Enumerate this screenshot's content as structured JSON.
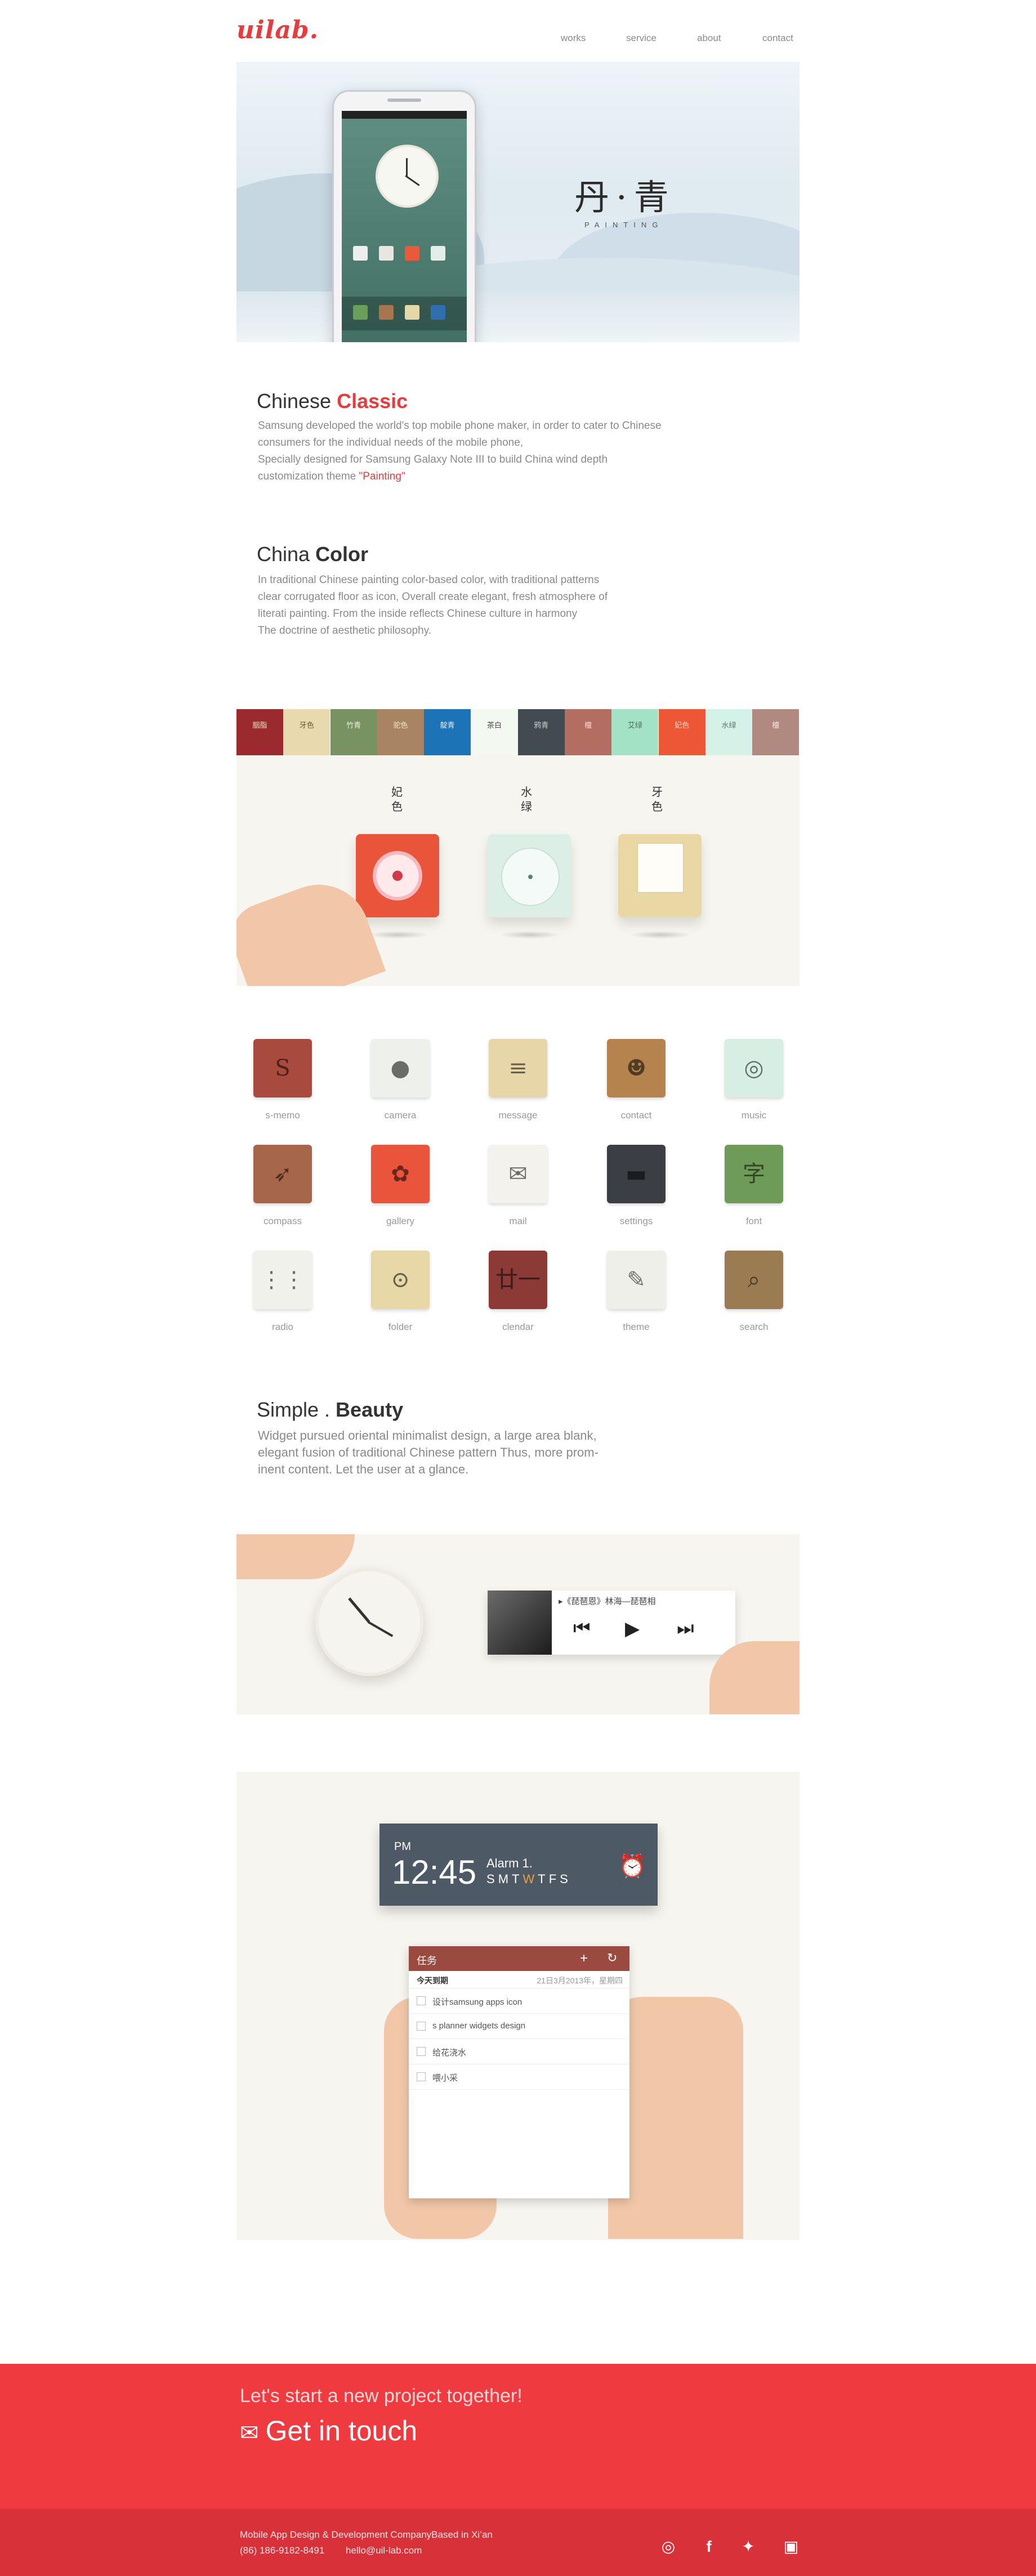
{
  "header": {
    "logo": "uilab.",
    "nav": [
      "works",
      "service",
      "about",
      "contact"
    ]
  },
  "hero": {
    "title": "丹·青",
    "subtitle": "PAINTING"
  },
  "classic": {
    "title_light": "Chinese ",
    "title_accent": "Classic",
    "line1": "Samsung developed the world's top mobile phone maker, in order to cater to Chinese",
    "line2": "consumers for the individual needs of the mobile phone,",
    "line3": "Specially designed for Samsung Galaxy Note III to build China wind depth",
    "line4_prefix": "customization theme ",
    "line4_accent": "\"Painting\""
  },
  "color": {
    "title_light": "China ",
    "title_bold": "Color",
    "line1": "In traditional Chinese painting color-based color, with traditional patterns",
    "line2": "clear corrugated floor as icon, Overall create elegant, fresh atmosphere of",
    "line3": "literati painting. From the inside reflects Chinese culture in harmony",
    "line4": "The doctrine of aesthetic philosophy."
  },
  "swatches": [
    {
      "label": "胭脂",
      "bg": "#9b2a2f",
      "fg": "#f2d6c4"
    },
    {
      "label": "牙色",
      "bg": "#e9d9ae",
      "fg": "#6b5a3a"
    },
    {
      "label": "竹青",
      "bg": "#789262",
      "fg": "#f0efe0"
    },
    {
      "label": "驼色",
      "bg": "#a88462",
      "fg": "#f4e6d0"
    },
    {
      "label": "靛青",
      "bg": "#1c73b5",
      "fg": "#dfeefa"
    },
    {
      "label": "茶白",
      "bg": "#f3f9f1",
      "fg": "#4a4a4a"
    },
    {
      "label": "鸦青",
      "bg": "#424c50",
      "fg": "#c9cfd1"
    },
    {
      "label": "檀",
      "bg": "#b36d61",
      "fg": "#f7dfd6"
    },
    {
      "label": "艾绿",
      "bg": "#a4e2c6",
      "fg": "#4d6e5f"
    },
    {
      "label": "妃色",
      "bg": "#ed5736",
      "fg": "#fde1d6"
    },
    {
      "label": "水绿",
      "bg": "#d4f2e7",
      "fg": "#56786b"
    },
    {
      "label": "檀",
      "bg": "#b08a80",
      "fg": "#f6e8e2"
    }
  ],
  "stage": {
    "labels": [
      "妃色",
      "水绿",
      "牙色"
    ]
  },
  "icons": [
    {
      "label": "s-memo",
      "bg": "#a94a3e",
      "glyph": "S"
    },
    {
      "label": "camera",
      "bg": "#eef0ec",
      "glyph": "●"
    },
    {
      "label": "message",
      "bg": "#e7d6a8",
      "glyph": "≡"
    },
    {
      "label": "contact",
      "bg": "#b5844e",
      "glyph": "☻"
    },
    {
      "label": "music",
      "bg": "#d6eee4",
      "glyph": "◎"
    },
    {
      "label": "compass",
      "bg": "#a5664a",
      "glyph": "➶"
    },
    {
      "label": "gallery",
      "bg": "#e9553a",
      "glyph": "✿"
    },
    {
      "label": "mail",
      "bg": "#f4f2ec",
      "glyph": "✉"
    },
    {
      "label": "settings",
      "bg": "#3b3f44",
      "glyph": "▬"
    },
    {
      "label": "font",
      "bg": "#6f9b58",
      "glyph": "字"
    },
    {
      "label": "radio",
      "bg": "#f1f1ec",
      "glyph": "⋮⋮"
    },
    {
      "label": "folder",
      "bg": "#e8d8a8",
      "glyph": "⊙"
    },
    {
      "label": "clendar",
      "bg": "#8b3a36",
      "glyph": "廿一"
    },
    {
      "label": "theme",
      "bg": "#efefe9",
      "glyph": "✎"
    },
    {
      "label": "search",
      "bg": "#9b7b52",
      "glyph": "⌕"
    }
  ],
  "beauty": {
    "title_light": "Simple . ",
    "title_bold": "Beauty",
    "line1": "Widget pursued oriental minimalist design, a large area blank,",
    "line2": "elegant fusion of traditional Chinese pattern Thus, more prom-",
    "line3": "inent content. Let the user at a glance."
  },
  "player": {
    "track": "▸《琵琶恩》林海—琵琶相"
  },
  "alarm": {
    "ampm": "PM",
    "time": "12:45",
    "name": "Alarm 1.",
    "days": [
      "S",
      "M",
      "T",
      "W",
      "T",
      "F",
      "S"
    ]
  },
  "tasks": {
    "title": "任务",
    "due_label": "今天到期",
    "due_date": "21日3月2013年，星期四",
    "items": [
      "设计samsung apps icon",
      "s planner widgets design",
      "给花浇水",
      "喂小采"
    ]
  },
  "footer": {
    "cta": "Let's start a new project together!",
    "touch": "Get in touch",
    "company": "Mobile App Design & Development CompanyBased in Xi’an",
    "phone": "(86) 186-9182-8491",
    "email": "hello@uil-lab.com"
  },
  "colors": {
    "accent": "#e83b3b",
    "footer": "#ef3a3f",
    "footer_bar": "#d8313a",
    "panel": "#f7f5ef"
  }
}
